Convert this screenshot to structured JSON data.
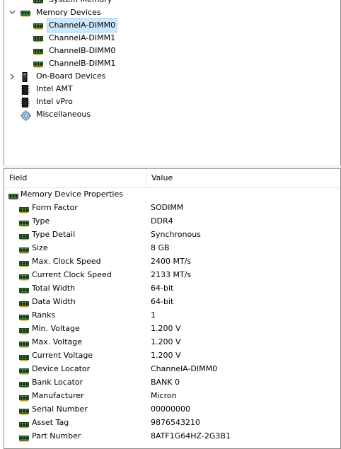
{
  "tree": {
    "items": [
      {
        "label": "System Memory",
        "icon": "ram-icon",
        "level": 2,
        "expander": "none",
        "selected": false
      },
      {
        "label": "Memory Devices",
        "icon": "ram-icon",
        "level": 1,
        "expander": "expanded",
        "selected": false
      },
      {
        "label": "ChannelA-DIMM0",
        "icon": "ram-icon",
        "level": 2,
        "expander": "none",
        "selected": true
      },
      {
        "label": "ChannelA-DIMM1",
        "icon": "ram-icon",
        "level": 2,
        "expander": "none",
        "selected": false
      },
      {
        "label": "ChannelB-DIMM0",
        "icon": "ram-icon",
        "level": 2,
        "expander": "none",
        "selected": false
      },
      {
        "label": "ChannelB-DIMM1",
        "icon": "ram-icon",
        "level": 2,
        "expander": "none",
        "selected": false
      },
      {
        "label": "On-Board Devices",
        "icon": "device-icon",
        "level": 1,
        "expander": "collapsed",
        "selected": false
      },
      {
        "label": "Intel AMT",
        "icon": "chip-icon",
        "level": 1,
        "expander": "none",
        "selected": false
      },
      {
        "label": "Intel vPro",
        "icon": "chip-icon",
        "level": 1,
        "expander": "none",
        "selected": false
      },
      {
        "label": "Miscellaneous",
        "icon": "gear-icon",
        "level": 1,
        "expander": "none",
        "selected": false
      }
    ]
  },
  "grid": {
    "columns": {
      "field": "Field",
      "value": "Value"
    },
    "group": {
      "label": "Memory Device Properties",
      "icon": "ram-icon"
    },
    "rows": [
      {
        "field": "Form Factor",
        "value": "SODIMM"
      },
      {
        "field": "Type",
        "value": "DDR4"
      },
      {
        "field": "Type Detail",
        "value": "Synchronous"
      },
      {
        "field": "Size",
        "value": "8 GB"
      },
      {
        "field": "Max. Clock Speed",
        "value": "2400 MT/s"
      },
      {
        "field": "Current Clock Speed",
        "value": "2133 MT/s"
      },
      {
        "field": "Total Width",
        "value": "64-bit"
      },
      {
        "field": "Data Width",
        "value": "64-bit"
      },
      {
        "field": "Ranks",
        "value": "1"
      },
      {
        "field": "Min. Voltage",
        "value": "1.200 V"
      },
      {
        "field": "Max. Voltage",
        "value": "1.200 V"
      },
      {
        "field": "Current Voltage",
        "value": "1.200 V"
      },
      {
        "field": "Device Locator",
        "value": "ChannelA-DIMM0"
      },
      {
        "field": "Bank Locator",
        "value": "BANK 0"
      },
      {
        "field": "Manufacturer",
        "value": "Micron"
      },
      {
        "field": "Serial Number",
        "value": "00000000"
      },
      {
        "field": "Asset Tag",
        "value": "9876543210"
      },
      {
        "field": "Part Number",
        "value": "8ATF1G64HZ-2G3B1"
      }
    ]
  },
  "colors": {
    "selection": "#cce8ff",
    "ram_green": "#2e7d32"
  }
}
